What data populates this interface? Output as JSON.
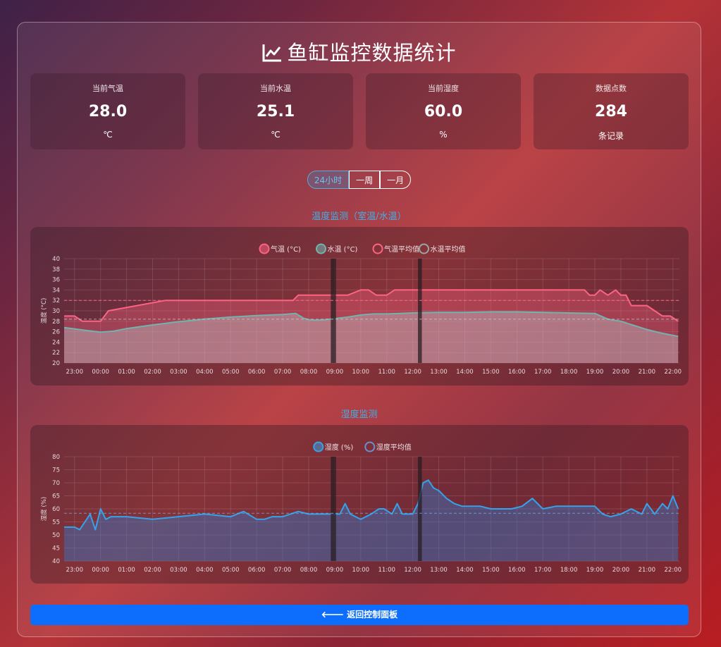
{
  "page_title": "鱼缸监控数据统计",
  "stats": [
    {
      "label": "当前气温",
      "value": "28.0",
      "unit": "℃"
    },
    {
      "label": "当前水温",
      "value": "25.1",
      "unit": "℃"
    },
    {
      "label": "当前湿度",
      "value": "60.0",
      "unit": "%"
    },
    {
      "label": "数据点数",
      "value": "284",
      "unit": "条记录"
    }
  ],
  "ranges": {
    "day": "24小时",
    "week": "一周",
    "month": "一月",
    "selected": "24小时"
  },
  "temp_section_title": "温度监测（室温/水温）",
  "hum_section_title": "湿度监测",
  "back_button": "返回控制面板",
  "colors": {
    "air": "#ff6384",
    "water": "#72b3ad",
    "humidity": "#36a2eb",
    "accent": "#0d6efd"
  },
  "chart_data": [
    {
      "type": "area",
      "x_ticks": [
        "23:00",
        "00:00",
        "01:00",
        "02:00",
        "03:00",
        "04:00",
        "05:00",
        "06:00",
        "07:00",
        "08:00",
        "09:00",
        "10:00",
        "11:00",
        "12:00",
        "13:00",
        "14:00",
        "15:00",
        "16:00",
        "17:00",
        "18:00",
        "19:00",
        "20:00",
        "21:00",
        "22:00"
      ],
      "ylabel": "温度 (°C)",
      "ylim": [
        20,
        40
      ],
      "y_ticks": [
        20,
        22,
        24,
        26,
        28,
        30,
        32,
        34,
        36,
        38,
        40
      ],
      "grid": true,
      "legend_position": "top",
      "series": [
        {
          "name": "气温 (°C)",
          "x": [
            22.6,
            23.0,
            23.3,
            23.8,
            24.0,
            24.3,
            26.5,
            26.8,
            27.0,
            27.2,
            31.4,
            31.6,
            31.9,
            33.0,
            33.3,
            33.5,
            34.0,
            34.3,
            34.6,
            35.0,
            35.3,
            35.5,
            42.6,
            42.8,
            43.0,
            43.2,
            43.5,
            43.8,
            44.0,
            44.2,
            44.4,
            45.0,
            45.3,
            45.6,
            45.9,
            46.2
          ],
          "y": [
            29,
            29,
            28,
            28,
            28,
            30,
            32,
            32,
            32,
            32,
            32,
            33,
            33,
            33,
            33,
            33,
            34,
            34,
            33,
            33,
            34,
            34,
            34,
            33,
            33,
            34,
            33,
            34,
            33,
            33,
            31,
            31,
            30,
            29,
            29,
            28
          ]
        },
        {
          "name": "水温 (°C)",
          "x": [
            22.6,
            23.5,
            24.0,
            24.5,
            25.0,
            26.0,
            27.0,
            28.0,
            29.0,
            30.0,
            31.0,
            31.5,
            31.8,
            32.0,
            32.3,
            32.6,
            33.0,
            33.5,
            34.0,
            34.5,
            35.0,
            35.5,
            36.0,
            37.0,
            38.0,
            39.0,
            40.0,
            41.0,
            42.0,
            43.0,
            43.5,
            44.0,
            44.5,
            45.0,
            45.5,
            46.0,
            46.2
          ],
          "y": [
            26.8,
            26.2,
            25.9,
            26.1,
            26.6,
            27.3,
            27.9,
            28.4,
            28.8,
            29.1,
            29.3,
            29.5,
            28.6,
            28.3,
            28.2,
            28.3,
            28.5,
            28.8,
            29.2,
            29.4,
            29.4,
            29.5,
            29.6,
            29.7,
            29.7,
            29.8,
            29.8,
            29.7,
            29.6,
            29.5,
            28.4,
            28.0,
            27.2,
            26.4,
            25.8,
            25.3,
            25.1
          ]
        },
        {
          "name": "气温平均值",
          "y_const": 32.0
        },
        {
          "name": "水温平均值",
          "y_const": 28.4
        }
      ],
      "gaps": [
        [
          32.85,
          33.05
        ],
        [
          36.2,
          36.35
        ]
      ]
    },
    {
      "type": "area",
      "x_ticks": [
        "23:00",
        "00:00",
        "01:00",
        "02:00",
        "03:00",
        "04:00",
        "05:00",
        "06:00",
        "07:00",
        "08:00",
        "09:00",
        "10:00",
        "11:00",
        "12:00",
        "13:00",
        "14:00",
        "15:00",
        "16:00",
        "17:00",
        "18:00",
        "19:00",
        "20:00",
        "21:00",
        "22:00"
      ],
      "ylabel": "湿度 (%)",
      "ylim": [
        40,
        80
      ],
      "y_ticks": [
        40,
        45,
        50,
        55,
        60,
        65,
        70,
        75,
        80
      ],
      "grid": true,
      "legend_position": "top",
      "series": [
        {
          "name": "湿度 (%)",
          "x": [
            22.6,
            23.0,
            23.2,
            23.4,
            23.6,
            23.8,
            24.0,
            24.2,
            24.4,
            25.0,
            26.0,
            27.0,
            28.0,
            29.0,
            29.5,
            30.0,
            30.3,
            30.6,
            31.0,
            31.6,
            32.0,
            32.3,
            32.6,
            33.2,
            33.4,
            33.6,
            34.0,
            34.4,
            34.7,
            34.9,
            35.2,
            35.4,
            35.6,
            35.8,
            36.0,
            36.2,
            36.4,
            36.6,
            36.8,
            37.0,
            37.3,
            37.6,
            37.9,
            38.2,
            38.6,
            39.0,
            39.4,
            39.8,
            40.2,
            40.6,
            41.0,
            41.5,
            42.0,
            42.5,
            43.0,
            43.3,
            43.6,
            44.0,
            44.4,
            44.8,
            45.0,
            45.3,
            45.6,
            45.8,
            46.0,
            46.2
          ],
          "y": [
            53,
            53,
            52,
            55,
            58,
            52,
            60,
            56,
            57,
            57,
            56,
            57,
            58,
            57,
            59,
            56,
            56,
            57,
            57,
            59,
            58,
            58,
            58,
            58,
            62,
            58,
            56,
            58,
            60,
            60,
            58,
            62,
            58,
            58,
            58,
            62,
            70,
            71,
            68,
            67,
            64,
            62,
            61,
            61,
            61,
            60,
            60,
            60,
            61,
            64,
            60,
            61,
            61,
            61,
            61,
            58,
            57,
            58,
            60,
            58,
            62,
            58,
            62,
            60,
            65,
            60
          ]
        },
        {
          "name": "湿度平均值",
          "y_const": 58.3
        }
      ],
      "gaps": [
        [
          32.85,
          33.05
        ],
        [
          36.2,
          36.35
        ]
      ]
    }
  ]
}
